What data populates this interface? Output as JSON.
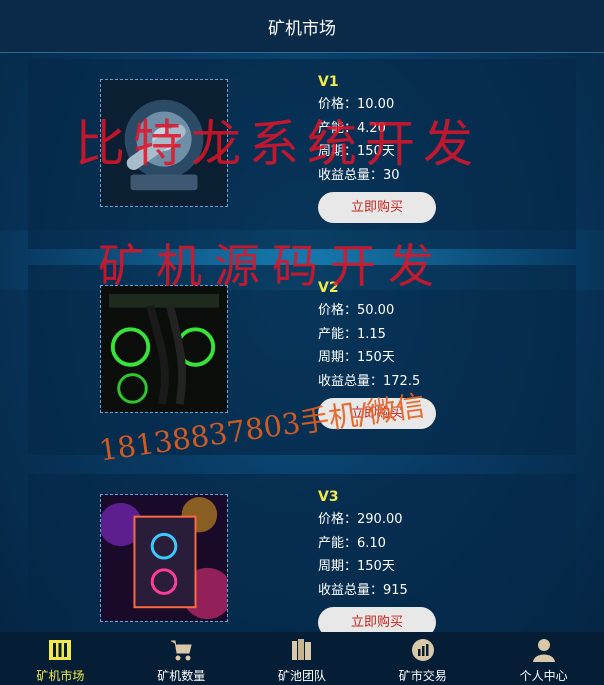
{
  "header": {
    "title": "矿机市场"
  },
  "products": [
    {
      "name": "V1",
      "price": "价格：10.00",
      "output": "产能：4.20",
      "cycle": "周期：150天",
      "total": "收益总量：30",
      "buy_label": "立即购买"
    },
    {
      "name": "V2",
      "price": "价格：50.00",
      "output": "产能：1.15",
      "cycle": "周期：150天",
      "total": "收益总量：172.5",
      "buy_label": "立即购买"
    },
    {
      "name": "V3",
      "price": "价格：290.00",
      "output": "产能：6.10",
      "cycle": "周期：150天",
      "total": "收益总量：915",
      "buy_label": "立即购买"
    }
  ],
  "watermarks": {
    "line1": "比特龙系统开发",
    "line2": "矿机源码开发",
    "line3": "18138837803手机/微信"
  },
  "tabbar": {
    "items": [
      {
        "label": "矿机市场",
        "icon": "market-icon",
        "active": true
      },
      {
        "label": "矿机数量",
        "icon": "cart-icon",
        "active": false
      },
      {
        "label": "矿池团队",
        "icon": "books-icon",
        "active": false
      },
      {
        "label": "矿市交易",
        "icon": "trade-chart-icon",
        "active": false
      },
      {
        "label": "个人中心",
        "icon": "user-icon",
        "active": false
      }
    ]
  },
  "colors": {
    "accent": "#f2e94a",
    "buy_text": "#c8241d",
    "watermark": "#e11428"
  }
}
